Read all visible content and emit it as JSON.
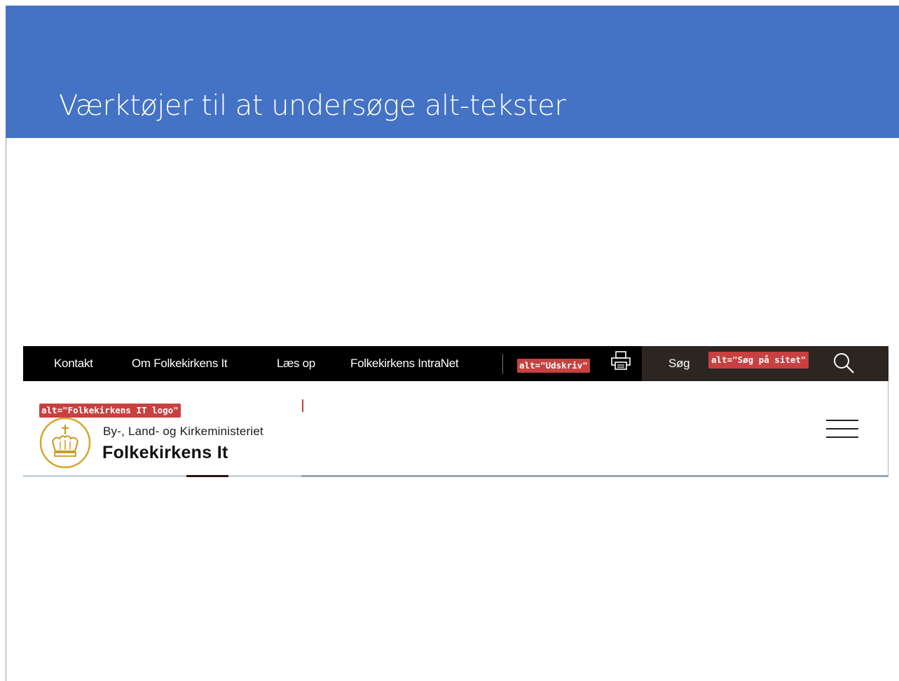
{
  "slide": {
    "title": "Værktøjer til at undersøge alt-tekster",
    "title_bg_color": "#4472c4"
  },
  "site": {
    "topnav": {
      "items": [
        {
          "label": "Kontakt"
        },
        {
          "label": "Om Folkekirkens It"
        },
        {
          "label": "Læs op"
        },
        {
          "label": "Folkekirkens IntraNet"
        }
      ],
      "print_alt": "alt=\"Udskriv\"",
      "print_icon": "printer-icon",
      "search_label": "Søg",
      "search_alt": "alt=\"Søg på sitet\"",
      "search_icon": "magnifier-icon"
    },
    "header": {
      "logo_alt": "alt=\"Folkekirkens IT logo\"",
      "logo_icon": "crown-icon",
      "ministry": "By-, Land- og Kirkeministeriet",
      "org_name": "Folkekirkens It",
      "menu_icon": "hamburger-icon"
    },
    "alt_tag_color": "#c84040"
  }
}
